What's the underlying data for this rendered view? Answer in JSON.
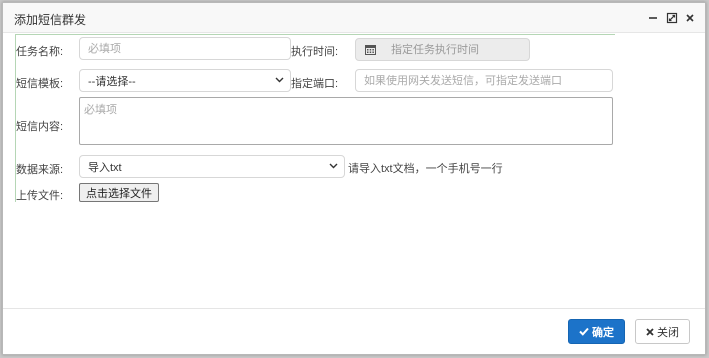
{
  "dialog": {
    "title": "添加短信群发",
    "controls": [
      "minimize-icon",
      "maximize-icon",
      "close-icon"
    ]
  },
  "form": {
    "task_name": {
      "label": "任务名称:",
      "placeholder": "必填项",
      "value": ""
    },
    "exec_time": {
      "label": "执行时间:",
      "placeholder": "指定任务执行时间",
      "value": ""
    },
    "template": {
      "label": "短信模板:",
      "selected": "--请选择--"
    },
    "port": {
      "label": "指定端口:",
      "placeholder": "如果使用网关发送短信，可指定发送端口",
      "value": ""
    },
    "content": {
      "label": "短信内容:",
      "placeholder": "必填项",
      "value": ""
    },
    "source": {
      "label": "数据来源:",
      "selected": "导入txt",
      "hint": "请导入txt文档，一个手机号一行"
    },
    "upload": {
      "label": "上传文件:",
      "button_label": "点击选择文件"
    }
  },
  "footer": {
    "ok_label": "确定",
    "close_label": "关闭"
  },
  "colors": {
    "primary": "#1c73c9",
    "readonly_bg": "#ececec"
  }
}
